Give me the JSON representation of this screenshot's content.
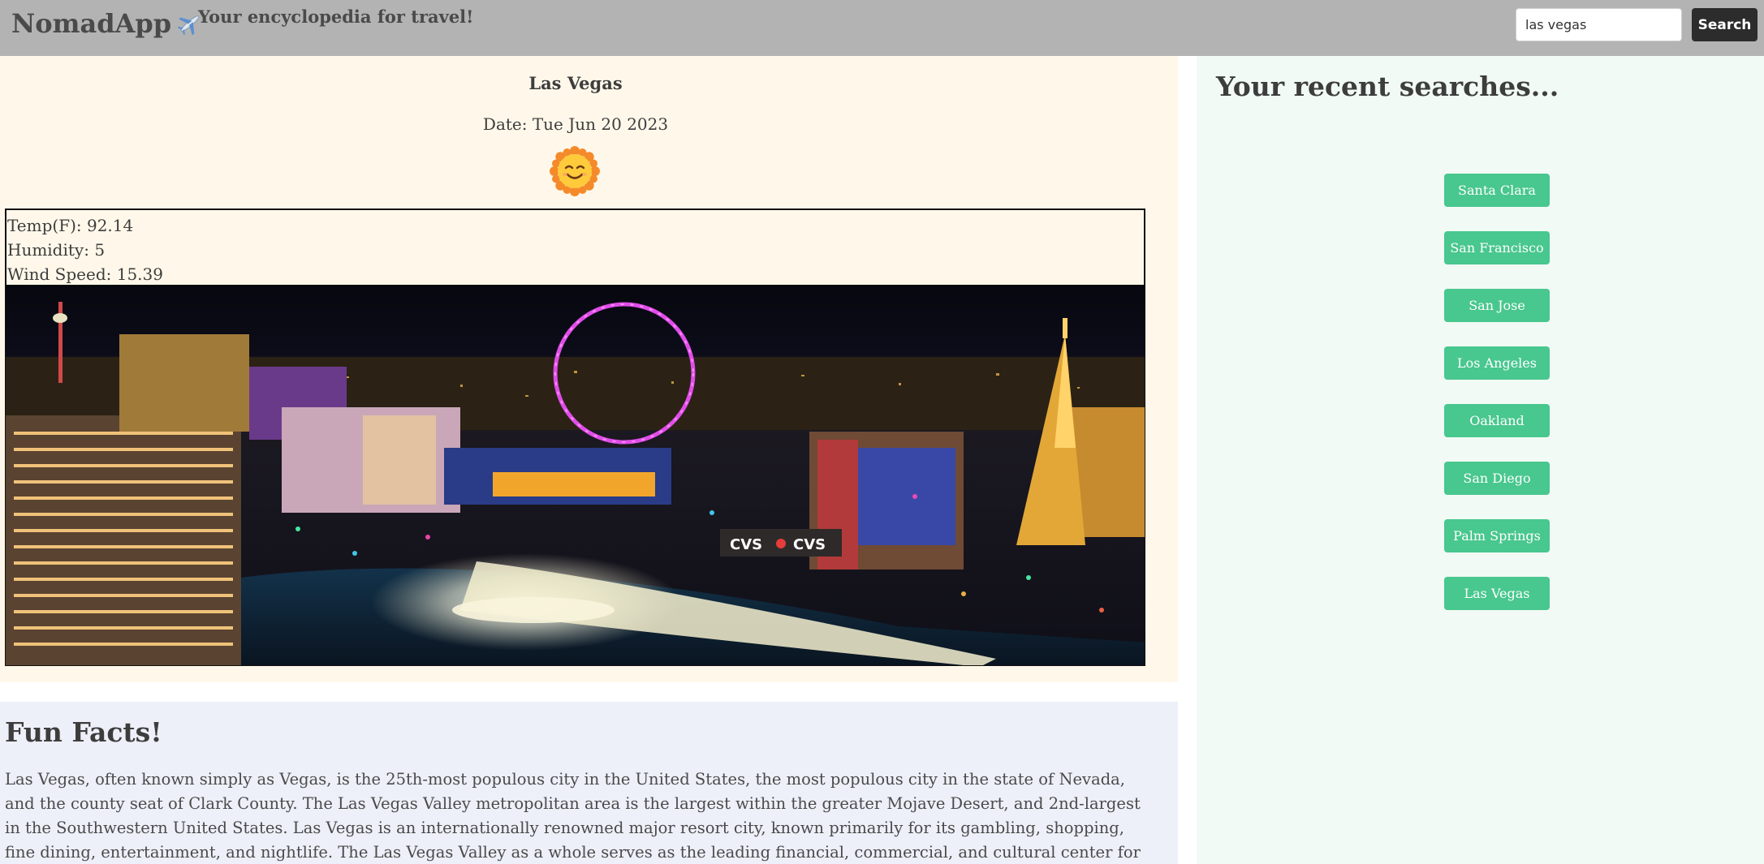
{
  "header": {
    "brand": "NomadApp",
    "tagline": "Your encyclopedia for travel!",
    "search_value": "las vegas",
    "search_button": "Search"
  },
  "weather": {
    "city": "Las Vegas",
    "date": "Date: Tue Jun 20 2023",
    "icon": "smiling-sun-icon",
    "temp": "Temp(F): 92.14",
    "humidity": "Humidity: 5",
    "wind": "Wind Speed: 15.39",
    "photo": "las-vegas-strip-night-photo"
  },
  "facts": {
    "title": "Fun Facts!",
    "text": "Las Vegas, often known simply as Vegas, is the 25th-most populous city in the United States, the most populous city in the state of Nevada, and the county seat of Clark County. The Las Vegas Valley metropolitan area is the largest within the greater Mojave Desert, and 2nd-largest in the Southwestern United States. Las Vegas is an internationally renowned major resort city, known primarily for its gambling, shopping, fine dining, entertainment, and nightlife. The Las Vegas Valley as a whole serves as the leading financial, commercial, and cultural center for Nevada."
  },
  "recent": {
    "title": "Your recent searches...",
    "items": [
      "Santa Clara",
      "San Francisco",
      "San Jose",
      "Los Angeles",
      "Oakland",
      "San Diego",
      "Palm Springs",
      "Las Vegas"
    ]
  },
  "colors": {
    "header_bg": "#b3b3b3",
    "weather_bg": "#fff8ea",
    "facts_bg": "#edf0f9",
    "recent_bg": "#f1faf5",
    "button_green": "#48c78e",
    "search_button_bg": "#2c2c2c"
  }
}
